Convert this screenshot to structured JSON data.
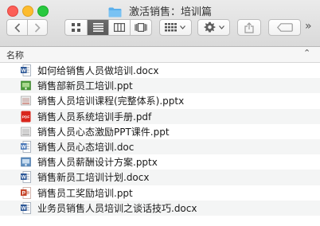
{
  "window": {
    "title": "激活销售：培训篇"
  },
  "toolbar": {
    "back_icon": "chevron-left-icon",
    "forward_icon": "chevron-right-icon",
    "view_modes": [
      "icon-view",
      "list-view",
      "column-view",
      "cover-flow-view"
    ],
    "active_view": "list-view",
    "arrange_icon": "grid-arrange-icon",
    "action_icon": "gear-icon",
    "share_icon": "share-icon",
    "tags_icon": "tag-icon",
    "overflow_glyph": "»"
  },
  "column": {
    "name_label": "名称",
    "chevron": "⌃"
  },
  "files": [
    {
      "name": "如何给销售人员做培训.docx",
      "type": "word"
    },
    {
      "name": "销售部新员工培训.ppt",
      "type": "keynote"
    },
    {
      "name": "销售人员培训课程(完整体系).pptx",
      "type": "ppt-doc"
    },
    {
      "name": "销售人员系统培训手册.pdf",
      "type": "pdf"
    },
    {
      "name": "销售人员心态激励PPT课件.ppt",
      "type": "ppt-doc"
    },
    {
      "name": "销售人员心态培训.doc",
      "type": "word-doc"
    },
    {
      "name": "销售人员薪酬设计方案.pptx",
      "type": "keynote"
    },
    {
      "name": "销售新员工培训计划.docx",
      "type": "word"
    },
    {
      "name": "销售员工奖励培训.ppt",
      "type": "ppt"
    },
    {
      "name": "业务员销售人员培训之谈话技巧.docx",
      "type": "word"
    }
  ],
  "colors": {
    "word": "#2b5797",
    "pdf": "#d9261c",
    "keynote": "#4a9a3a",
    "ppt": "#c6452a"
  }
}
